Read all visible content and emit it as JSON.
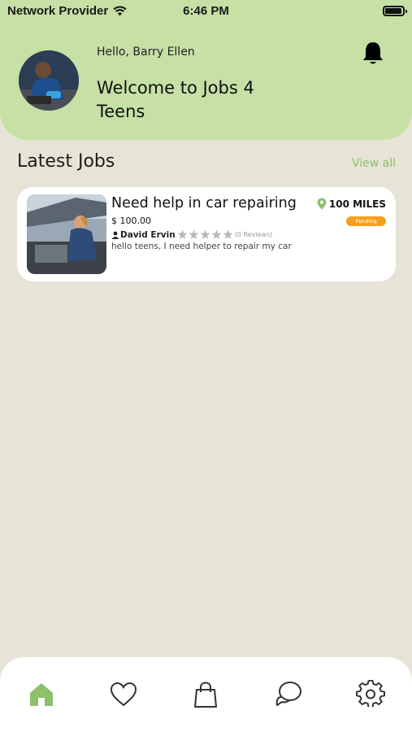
{
  "status_bar": {
    "carrier": "Network Provider",
    "time": "6:46 PM",
    "icons": [
      "wifi-icon",
      "battery-icon"
    ]
  },
  "header": {
    "greeting": "Hello, Barry Ellen",
    "welcome": "Welcome to Jobs 4 Teens",
    "icons": [
      "bell-icon"
    ]
  },
  "latest_jobs": {
    "title": "Latest Jobs",
    "view_all_label": "View all",
    "jobs": [
      {
        "title": "Need help in car repairing",
        "price": "$ 100.00",
        "poster": "David Ervin",
        "rating_stars": 0,
        "reviews": "(0 Reviews)",
        "description": "hello teens, I need helper to repair my car",
        "distance": "100 MILES",
        "status": "Pending"
      }
    ]
  },
  "bottom_nav": {
    "items": [
      "home-icon",
      "heart-icon",
      "shopping-bag-icon",
      "chat-icon",
      "settings-icon"
    ],
    "active": "home-icon"
  },
  "colors": {
    "header_bg": "#c6e0a6",
    "page_bg": "#e7e3d6",
    "accent": "#8cc16a",
    "pending": "#f6a01c"
  }
}
